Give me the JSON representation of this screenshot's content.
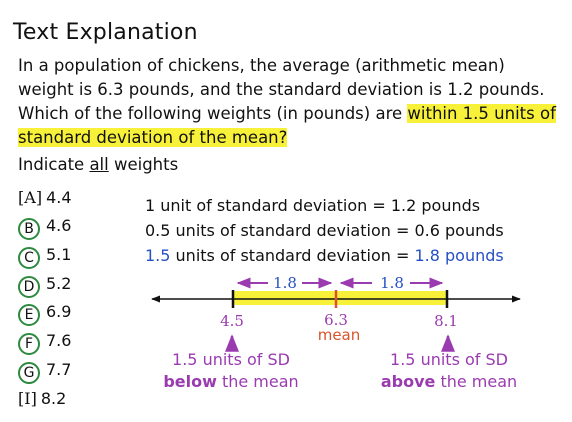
{
  "title": "Text Explanation",
  "question": {
    "text_before": "In a population of chickens, the average (arithmetic mean) weight is 6.3 pounds, and the standard deviation is 1.2 pounds. Which of the following weights (in pounds) are ",
    "highlighted": "within 1.5 units of standard deviation of the mean?"
  },
  "instruction": {
    "before": "Indicate ",
    "underlined": "all",
    "after": " weights"
  },
  "options": [
    {
      "label": "A",
      "value": "4.4",
      "selected": false
    },
    {
      "label": "B",
      "value": "4.6",
      "selected": true
    },
    {
      "label": "C",
      "value": "5.1",
      "selected": true
    },
    {
      "label": "D",
      "value": "5.2",
      "selected": true
    },
    {
      "label": "E",
      "value": "6.9",
      "selected": true
    },
    {
      "label": "F",
      "value": "7.6",
      "selected": true
    },
    {
      "label": "G",
      "value": "7.7",
      "selected": true
    },
    {
      "label": "I",
      "value": "8.2",
      "selected": false
    }
  ],
  "facts": [
    {
      "left": "1 unit of standard deviation = 1.2 pounds"
    },
    {
      "left": "0.5 units of standard deviation = 0.6 pounds"
    },
    {
      "left": "1.5",
      "middle": " units of standard deviation = ",
      "right": "1.8 pounds"
    }
  ],
  "number_line": {
    "span_left": "1.8",
    "span_right": "1.8",
    "low": "4.5",
    "mean_value": "6.3",
    "mean_label": "mean",
    "high": "8.1"
  },
  "captions": {
    "below_line1": "1.5 units of SD",
    "below_bold": "below",
    "below_rest": " the mean",
    "above_line1": "1.5 units of SD",
    "above_bold": "above",
    "above_rest": " the mean"
  },
  "colors": {
    "highlight": "#f7f13a",
    "circle": "#2d8a3f",
    "blue": "#2650c4",
    "purple": "#9a3bb0",
    "mean_red": "#d9542b"
  }
}
